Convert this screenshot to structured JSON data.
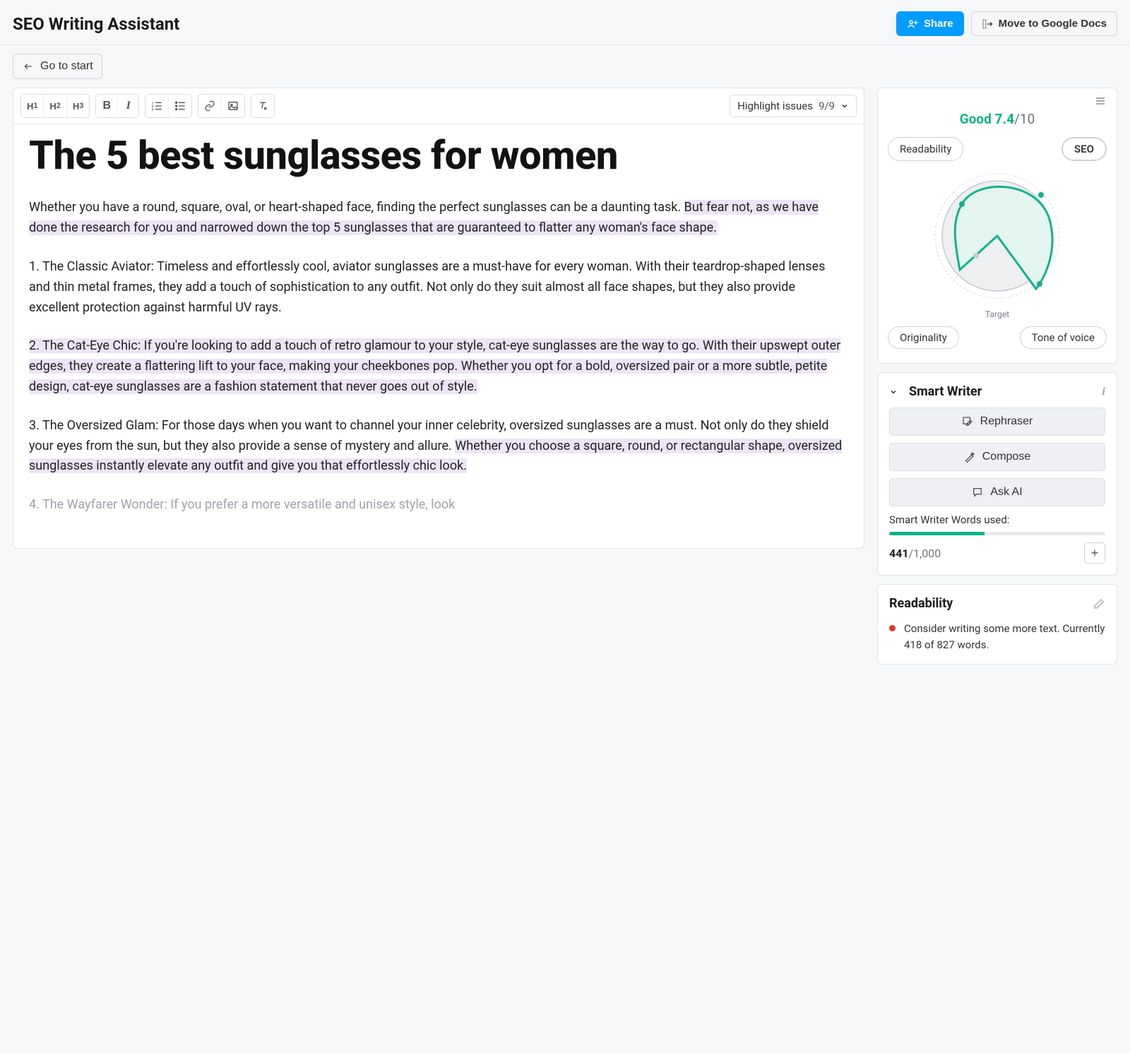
{
  "header": {
    "title": "SEO Writing Assistant",
    "share_label": "Share",
    "move_label": "Move to Google Docs"
  },
  "nav": {
    "back_label": "Go to start"
  },
  "toolbar": {
    "h1": "H1",
    "h2": "H2",
    "h3": "H3",
    "bold": "B",
    "italic": "I",
    "highlight_label": "Highlight issues",
    "highlight_count": "9/9"
  },
  "document": {
    "title": "The 5 best sunglasses for women",
    "p1_a": "Whether you have a round, square, oval, or heart-shaped face, finding the perfect sunglasses can be a daunting task. ",
    "p1_b": "But fear not, as we have done the research for you and narrowed down the top 5 sunglasses that are guaranteed to flatter any woman's face shape.",
    "p2": "1. The Classic Aviator: Timeless and effortlessly cool, aviator sunglasses are a must-have for every woman. With their teardrop-shaped lenses and thin metal frames, they add a touch of sophistication to any outfit. Not only do they suit almost all face shapes, but they also provide excellent protection against harmful UV rays.",
    "p3": "2. The Cat-Eye Chic: If you're looking to add a touch of retro glamour to your style, cat-eye sunglasses are the way to go. With their upswept outer edges, they create a flattering lift to your face, making your cheekbones pop. Whether you opt for a bold, oversized pair or a more subtle, petite design, cat-eye sunglasses are a fashion statement that never goes out of style.",
    "p4_a": "3. The Oversized Glam: For those days when you want to channel your inner celebrity, oversized sunglasses are a must. Not only do they shield your eyes from the sun, but they also provide a sense of mystery and allure. ",
    "p4_b": "Whether you choose a square, round, or rectangular shape, oversized sunglasses instantly elevate any outfit and give you that effortlessly chic look.",
    "p5": "4. The Wayfarer Wonder: If you prefer a more versatile and unisex style, look"
  },
  "score": {
    "status": "Good",
    "value": "7.4",
    "max": "/10",
    "pills": {
      "readability": "Readability",
      "seo": "SEO",
      "originality": "Originality",
      "tone": "Tone of voice"
    },
    "target_label": "Target"
  },
  "smart_writer": {
    "title": "Smart Writer",
    "rephraser": "Rephraser",
    "compose": "Compose",
    "ask_ai": "Ask AI",
    "usage_label": "Smart Writer Words used:",
    "used": "441",
    "total": "/1,000",
    "percent": 44.1
  },
  "readability": {
    "title": "Readability",
    "issue1": "Consider writing some more text. Currently 418 of 827 words."
  }
}
